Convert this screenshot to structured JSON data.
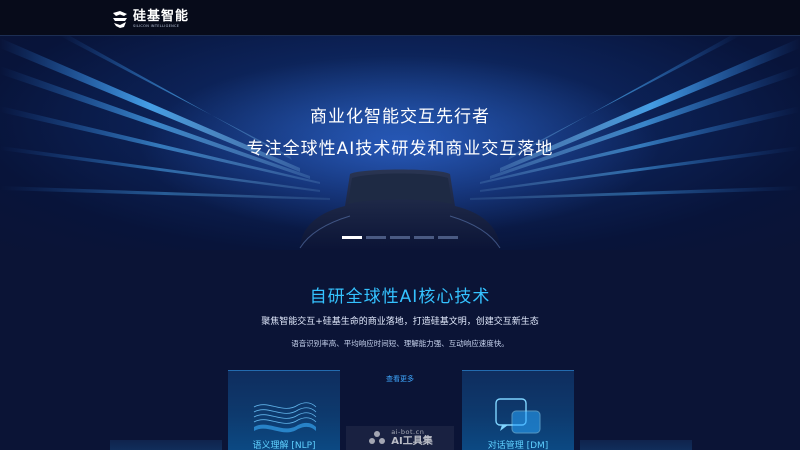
{
  "header": {
    "logo_cn": "硅基智能",
    "logo_en": "SILICON INTELLIGENCE",
    "logo_icon": "silicon-logo-icon"
  },
  "hero": {
    "line1": "商业化智能交互先行者",
    "line2": "专注全球性AI技术研发和商业交互落地",
    "slides_total": 5,
    "active_slide": 1
  },
  "tech": {
    "title": "自研全球性AI核心技术",
    "subtitle": "聚焦智能交互+硅基生命的商业落地，打造硅基文明，创建交互新生态",
    "description": "语音识别率高、平均响应时间短、理解能力强、互动响应速度快。",
    "more_label": "查看更多",
    "cards": [
      {
        "label": "语义理解 [NLP]",
        "icon": "layered-waves-icon"
      },
      {
        "label": "对话管理 [DM]",
        "icon": "chat-bubbles-icon"
      }
    ]
  },
  "watermark": {
    "url": "ai-bot.cn",
    "name": "AI工具集"
  },
  "colors": {
    "accent": "#34c2ff",
    "link": "#3fa8ff",
    "page_bg": "#0b1436",
    "header_bg": "#070b1a"
  }
}
